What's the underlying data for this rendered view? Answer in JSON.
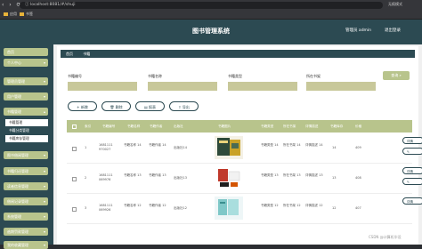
{
  "browser": {
    "url": "localhost:8081/#/shuji",
    "profile": "无痕模式",
    "bookmarks": [
      "应用",
      "书签"
    ]
  },
  "header": {
    "title": "图书管理系统",
    "admin": "管理员 admin",
    "logout": "退出登录"
  },
  "sidebar": {
    "items": [
      {
        "label": "首页"
      },
      {
        "label": "个人中心"
      },
      {
        "label": "管理员管理"
      },
      {
        "label": "用户管理"
      },
      {
        "label": "书籍管理"
      },
      {
        "label": "图书借阅管理"
      },
      {
        "label": "书籍归还管理"
      },
      {
        "label": "读者信息管理"
      },
      {
        "label": "借阅记录管理"
      },
      {
        "label": "系统管理"
      },
      {
        "label": "逾期罚款管理"
      },
      {
        "label": "我的收藏管理"
      }
    ],
    "submenu": [
      {
        "label": "书籍管理"
      },
      {
        "label": "书籍分类管理"
      },
      {
        "label": "书籍库存管理"
      }
    ]
  },
  "breadcrumb": {
    "home": "首页",
    "current": "书籍"
  },
  "search": {
    "labels": [
      "书籍编号",
      "书籍名称",
      "书籍类型",
      "所在书架"
    ],
    "button": "查询"
  },
  "actions": {
    "add": "新增",
    "delete": "删除",
    "report": "报表",
    "export": "导出"
  },
  "table": {
    "headers": [
      "索引",
      "书籍编号",
      "书籍名称",
      "书籍作者",
      "出版社",
      "书籍图片",
      "书籍类型",
      "所在书架",
      "详情描述",
      "书籍库存",
      "价格"
    ],
    "rows": [
      {
        "index": "1",
        "code": "1681111 970027",
        "name": "书籍名称 14",
        "author": "书籍作者 14",
        "publisher": "出版社14",
        "type": "书籍类型 14",
        "shelf": "所在书架 14",
        "desc": "详情描述 14",
        "stock": "14",
        "price": "409"
      },
      {
        "index": "2",
        "code": "1681111 069976",
        "name": "书籍名称 13",
        "author": "书籍作者 13",
        "publisher": "出版社13",
        "type": "书籍类型 13",
        "shelf": "所在书架 13",
        "desc": "详情描述 13",
        "stock": "13",
        "price": "408"
      },
      {
        "index": "3",
        "code": "1681111 069926",
        "name": "书籍名称 12",
        "author": "书籍作者 12",
        "publisher": "出版社12",
        "type": "书籍类型 12",
        "shelf": "所在书架 12",
        "desc": "详情描述 12",
        "stock": "12",
        "price": "407"
      }
    ],
    "op_label": "详情"
  },
  "watermark": "CSDN @计算机毕设",
  "colors": {
    "primary": "#2c4a52",
    "accent": "#b8c48c",
    "input": "#c8c89a"
  }
}
